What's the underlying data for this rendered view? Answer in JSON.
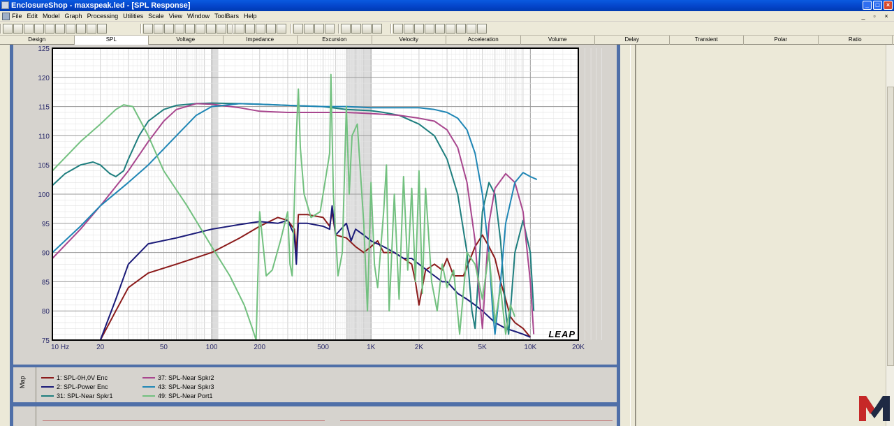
{
  "window": {
    "title": "EnclosureShop - maxspeak.led - [SPL Response]",
    "controls": [
      "minimize",
      "maximize",
      "close"
    ]
  },
  "menu": [
    "File",
    "Edit",
    "Model",
    "Graph",
    "Processing",
    "Utilities",
    "Scale",
    "View",
    "Window",
    "ToolBars",
    "Help"
  ],
  "toolbar": {
    "icons": [
      "new-icon",
      "open-icon",
      "save-icon",
      "save-all-icon",
      "import-icon",
      "export-icon",
      "copy-icon",
      "paste-icon",
      "print-icon",
      "preview-icon",
      "zoom-in-icon",
      "zoom-out-icon",
      "graph-a-icon",
      "graph-b-icon",
      "graph-c-icon",
      "graph-d-icon",
      "graph-e-icon",
      "graph-f-icon",
      "graph-g-icon",
      "speaker-icon",
      "driver-icon",
      "box-icon",
      "port-icon",
      "measure-icon",
      "grid-icon",
      "window-a-icon",
      "window-b-icon",
      "window-c-icon",
      "overlay-a-icon",
      "overlay-b-icon",
      "overlay-c-icon",
      "rotate-icon",
      "cursor-a-icon",
      "cursor-b-icon",
      "cursor-c-icon",
      "cursor-d-icon",
      "cursor-e-icon",
      "cursor-f-icon",
      "cursor-g-icon",
      "cursor-h-icon",
      "cursor-i-icon"
    ]
  },
  "tabs": [
    {
      "label": "Design",
      "active": false
    },
    {
      "label": "SPL",
      "active": true
    },
    {
      "label": "Voltage",
      "active": false
    },
    {
      "label": "Impedance",
      "active": false
    },
    {
      "label": "Excursion",
      "active": false
    },
    {
      "label": "Velocity",
      "active": false
    },
    {
      "label": "Acceleration",
      "active": false
    },
    {
      "label": "Volume",
      "active": false
    },
    {
      "label": "Delay",
      "active": false
    },
    {
      "label": "Transient",
      "active": false
    },
    {
      "label": "Polar",
      "active": false
    },
    {
      "label": "Ratio",
      "active": false
    }
  ],
  "map_label": "Map",
  "watermark": "LEAP",
  "chart_data": {
    "type": "line",
    "title": "",
    "xlabel": "",
    "ylabel": "",
    "x_scale": "log",
    "xlim": [
      10,
      20000
    ],
    "ylim": [
      75,
      125
    ],
    "grid": true,
    "x_tick_labels": [
      {
        "value": 10,
        "label": "10  Hz"
      },
      {
        "value": 20,
        "label": "20"
      },
      {
        "value": 50,
        "label": "50"
      },
      {
        "value": 100,
        "label": "100"
      },
      {
        "value": 200,
        "label": "200"
      },
      {
        "value": 500,
        "label": "500"
      },
      {
        "value": 1000,
        "label": "1K"
      },
      {
        "value": 2000,
        "label": "2K"
      },
      {
        "value": 5000,
        "label": "5K"
      },
      {
        "value": 10000,
        "label": "10K"
      },
      {
        "value": 20000,
        "label": "20K"
      }
    ],
    "y_ticks": [
      75,
      80,
      85,
      90,
      95,
      100,
      105,
      110,
      115,
      120,
      125
    ],
    "series": [
      {
        "name": "1: SPL-0H,0V Enc",
        "color": "#8b1a1a",
        "points": [
          [
            20,
            75
          ],
          [
            25,
            80
          ],
          [
            30,
            84
          ],
          [
            40,
            86.5
          ],
          [
            60,
            88
          ],
          [
            100,
            90
          ],
          [
            150,
            92.5
          ],
          [
            200,
            94.5
          ],
          [
            260,
            96
          ],
          [
            300,
            95.5
          ],
          [
            330,
            94
          ],
          [
            340,
            90
          ],
          [
            350,
            96.5
          ],
          [
            400,
            96.5
          ],
          [
            500,
            96
          ],
          [
            550,
            94.5
          ],
          [
            570,
            97
          ],
          [
            600,
            93
          ],
          [
            700,
            92.5
          ],
          [
            800,
            91
          ],
          [
            900,
            90
          ],
          [
            1000,
            91
          ],
          [
            1100,
            92
          ],
          [
            1200,
            90
          ],
          [
            1400,
            90
          ],
          [
            1600,
            89
          ],
          [
            1800,
            88
          ],
          [
            1900,
            85
          ],
          [
            2000,
            81
          ],
          [
            2200,
            87
          ],
          [
            2500,
            88
          ],
          [
            2800,
            87
          ],
          [
            3000,
            89
          ],
          [
            3300,
            86
          ],
          [
            3800,
            86
          ],
          [
            4500,
            91
          ],
          [
            5000,
            93
          ],
          [
            5500,
            91
          ],
          [
            6000,
            89
          ],
          [
            6500,
            85
          ],
          [
            7000,
            82
          ],
          [
            7500,
            79
          ],
          [
            8000,
            78
          ],
          [
            9000,
            77
          ],
          [
            10000,
            75.5
          ]
        ]
      },
      {
        "name": "2: SPL-Power Enc",
        "color": "#1a1a78",
        "points": [
          [
            20,
            75
          ],
          [
            25,
            82
          ],
          [
            30,
            88
          ],
          [
            40,
            91.5
          ],
          [
            60,
            92.5
          ],
          [
            100,
            94
          ],
          [
            150,
            94.8
          ],
          [
            200,
            95.3
          ],
          [
            260,
            95
          ],
          [
            300,
            95.5
          ],
          [
            330,
            93
          ],
          [
            340,
            88
          ],
          [
            350,
            95
          ],
          [
            400,
            95
          ],
          [
            500,
            94.5
          ],
          [
            550,
            94
          ],
          [
            570,
            98
          ],
          [
            600,
            93
          ],
          [
            700,
            95
          ],
          [
            750,
            92
          ],
          [
            800,
            94
          ],
          [
            900,
            93
          ],
          [
            1000,
            92
          ],
          [
            1200,
            91
          ],
          [
            1400,
            90
          ],
          [
            1600,
            89
          ],
          [
            1800,
            89
          ],
          [
            2000,
            88
          ],
          [
            2500,
            86
          ],
          [
            2800,
            85
          ],
          [
            3000,
            85
          ],
          [
            3500,
            83
          ],
          [
            4000,
            82
          ],
          [
            4500,
            81
          ],
          [
            5000,
            80
          ],
          [
            6000,
            78
          ],
          [
            7000,
            77
          ],
          [
            8000,
            76.5
          ],
          [
            9000,
            76
          ],
          [
            10000,
            75.5
          ]
        ]
      },
      {
        "name": "31: SPL-Near Spkr1",
        "color": "#1e7e7e",
        "points": [
          [
            10,
            101.5
          ],
          [
            12,
            103.5
          ],
          [
            15,
            105
          ],
          [
            18,
            105.5
          ],
          [
            20,
            105
          ],
          [
            23,
            103.5
          ],
          [
            25,
            103
          ],
          [
            28,
            104
          ],
          [
            30,
            106
          ],
          [
            35,
            110
          ],
          [
            40,
            112.5
          ],
          [
            50,
            114.5
          ],
          [
            60,
            115.2
          ],
          [
            80,
            115.5
          ],
          [
            100,
            115.6
          ],
          [
            150,
            115.5
          ],
          [
            200,
            115.4
          ],
          [
            300,
            115.2
          ],
          [
            500,
            115
          ],
          [
            700,
            114.5
          ],
          [
            1000,
            114.3
          ],
          [
            1200,
            114
          ],
          [
            1500,
            113.5
          ],
          [
            2000,
            112
          ],
          [
            2500,
            110
          ],
          [
            3000,
            106
          ],
          [
            3500,
            100
          ],
          [
            4000,
            90
          ],
          [
            4300,
            80
          ],
          [
            4500,
            77
          ],
          [
            5000,
            97
          ],
          [
            5500,
            102
          ],
          [
            6000,
            100
          ],
          [
            6500,
            92
          ],
          [
            7000,
            80
          ],
          [
            7300,
            76
          ],
          [
            8000,
            90
          ],
          [
            9000,
            95.5
          ],
          [
            10000,
            90
          ],
          [
            10500,
            80
          ]
        ]
      },
      {
        "name": "37: SPL-Near Spkr2",
        "color": "#a8468e",
        "points": [
          [
            10,
            89
          ],
          [
            15,
            94
          ],
          [
            20,
            98
          ],
          [
            30,
            104
          ],
          [
            40,
            109
          ],
          [
            50,
            112.5
          ],
          [
            60,
            114.5
          ],
          [
            80,
            115.5
          ],
          [
            100,
            115.4
          ],
          [
            150,
            114.8
          ],
          [
            200,
            114.2
          ],
          [
            300,
            114
          ],
          [
            500,
            114
          ],
          [
            700,
            114
          ],
          [
            1000,
            113.8
          ],
          [
            1500,
            113.5
          ],
          [
            2000,
            113
          ],
          [
            2500,
            112.5
          ],
          [
            3000,
            111
          ],
          [
            3500,
            108
          ],
          [
            4000,
            102
          ],
          [
            4500,
            92
          ],
          [
            4700,
            85
          ],
          [
            5000,
            77
          ],
          [
            5500,
            95
          ],
          [
            6000,
            101
          ],
          [
            7000,
            103.5
          ],
          [
            8000,
            102
          ],
          [
            9000,
            97
          ],
          [
            10000,
            85
          ],
          [
            10500,
            76
          ]
        ]
      },
      {
        "name": "43: SPL-Near Spkr3",
        "color": "#1f86b5",
        "points": [
          [
            10,
            90
          ],
          [
            15,
            94.5
          ],
          [
            20,
            98
          ],
          [
            30,
            102
          ],
          [
            40,
            105
          ],
          [
            60,
            110
          ],
          [
            80,
            113.5
          ],
          [
            100,
            115
          ],
          [
            150,
            115.5
          ],
          [
            200,
            115.4
          ],
          [
            300,
            115.2
          ],
          [
            500,
            115
          ],
          [
            700,
            115
          ],
          [
            1000,
            114.8
          ],
          [
            1500,
            114.8
          ],
          [
            2000,
            114.8
          ],
          [
            2500,
            114.5
          ],
          [
            3000,
            114
          ],
          [
            3500,
            113
          ],
          [
            4000,
            111
          ],
          [
            4500,
            107
          ],
          [
            5000,
            100
          ],
          [
            5500,
            90
          ],
          [
            5800,
            80
          ],
          [
            6000,
            76
          ],
          [
            6500,
            85
          ],
          [
            7000,
            95
          ],
          [
            8000,
            102
          ],
          [
            9000,
            103.7
          ],
          [
            10000,
            103
          ],
          [
            11000,
            102.5
          ]
        ]
      },
      {
        "name": "49: SPL-Near Port1",
        "color": "#72c07f",
        "points": [
          [
            10,
            104
          ],
          [
            15,
            109
          ],
          [
            20,
            112
          ],
          [
            25,
            114.5
          ],
          [
            28,
            115.3
          ],
          [
            32,
            115
          ],
          [
            40,
            110
          ],
          [
            50,
            104
          ],
          [
            70,
            98
          ],
          [
            100,
            91
          ],
          [
            130,
            86
          ],
          [
            160,
            81
          ],
          [
            180,
            77
          ],
          [
            190,
            75
          ],
          [
            200,
            97
          ],
          [
            220,
            86
          ],
          [
            240,
            87
          ],
          [
            270,
            92
          ],
          [
            300,
            97
          ],
          [
            310,
            88
          ],
          [
            320,
            86
          ],
          [
            340,
            110
          ],
          [
            350,
            118
          ],
          [
            360,
            108
          ],
          [
            380,
            100
          ],
          [
            420,
            96
          ],
          [
            480,
            97
          ],
          [
            550,
            107
          ],
          [
            560,
            120.5
          ],
          [
            580,
            100
          ],
          [
            620,
            86
          ],
          [
            660,
            90
          ],
          [
            700,
            115
          ],
          [
            730,
            100
          ],
          [
            760,
            110
          ],
          [
            820,
            112
          ],
          [
            900,
            95
          ],
          [
            950,
            80
          ],
          [
            1000,
            102
          ],
          [
            1050,
            88
          ],
          [
            1100,
            84
          ],
          [
            1200,
            97
          ],
          [
            1250,
            105
          ],
          [
            1300,
            80
          ],
          [
            1400,
            100
          ],
          [
            1500,
            82
          ],
          [
            1600,
            103
          ],
          [
            1700,
            87
          ],
          [
            1800,
            101
          ],
          [
            1900,
            85
          ],
          [
            2000,
            104
          ],
          [
            2100,
            83
          ],
          [
            2200,
            101
          ],
          [
            2400,
            85
          ],
          [
            2600,
            80
          ],
          [
            2800,
            88
          ],
          [
            3000,
            84
          ],
          [
            3300,
            87
          ],
          [
            3600,
            76
          ],
          [
            4000,
            90
          ],
          [
            4500,
            88
          ],
          [
            5000,
            82
          ],
          [
            5500,
            90
          ],
          [
            6000,
            78
          ],
          [
            6500,
            84
          ],
          [
            7000,
            76
          ],
          [
            7500,
            81
          ],
          [
            8000,
            79
          ]
        ]
      }
    ]
  }
}
